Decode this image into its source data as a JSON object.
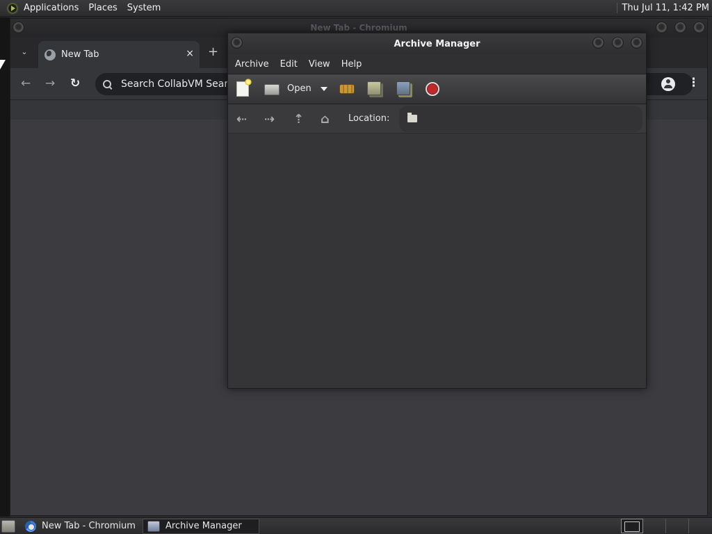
{
  "top_panel": {
    "menus": [
      "Applications",
      "Places",
      "System"
    ],
    "clock": "Thu Jul 11,  1:42 PM"
  },
  "chromium": {
    "window_title": "New Tab - Chromium",
    "tab_title": "New Tab",
    "tab_close": "×",
    "new_tab": "+",
    "tab_dropdown": "⌄",
    "back": "←",
    "forward": "→",
    "reload": "↻",
    "omnibox_text": "Search CollabVM SearXNG or type a URL",
    "menu": "⋮"
  },
  "archive_manager": {
    "window_title": "Archive Manager",
    "menubar": [
      "Archive",
      "Edit",
      "View",
      "Help"
    ],
    "toolbar": {
      "open_label": "Open"
    },
    "location": {
      "back": "⇠",
      "forward": "⇢",
      "up": "⇡",
      "home": "⌂",
      "label": "Location:"
    }
  },
  "taskbar": {
    "tasks": [
      {
        "label": "New Tab - Chromium",
        "icon": "chromium-icon"
      },
      {
        "label": "Archive Manager",
        "icon": "archive-manager-icon"
      }
    ]
  },
  "colors": {
    "panel_bg": "#2c2c2e",
    "window_bg": "#353537",
    "stop_red": "#c0282c"
  }
}
